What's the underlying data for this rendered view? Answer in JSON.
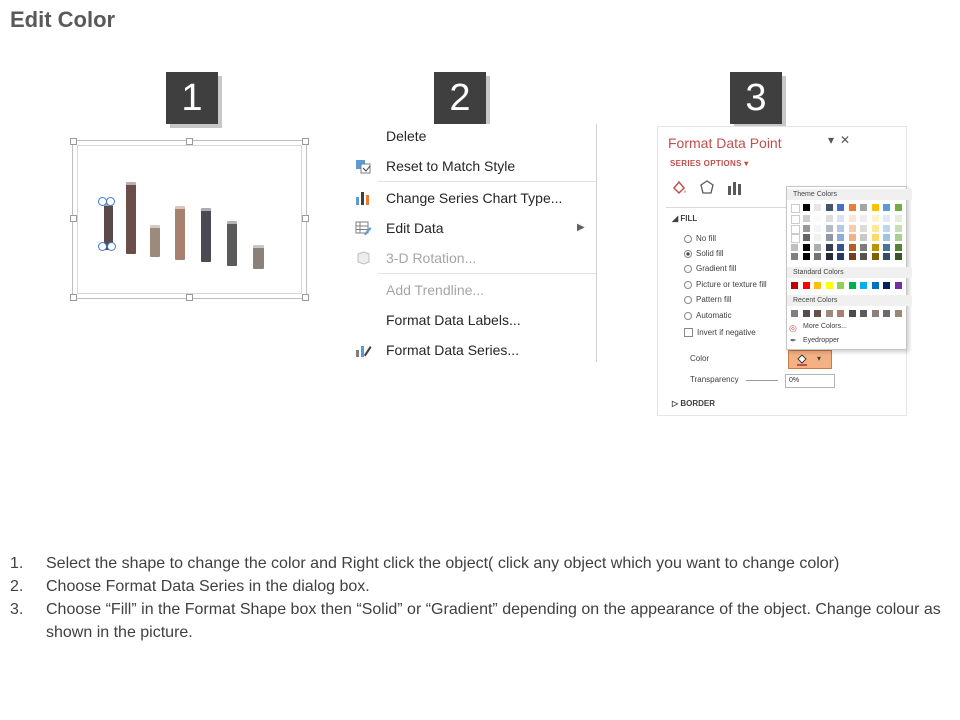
{
  "title": "Edit Color",
  "steps": [
    "1",
    "2",
    "3"
  ],
  "chart_bar_colors": [
    "#5a4a4e",
    "#6a4e4a",
    "#9c8a7a",
    "#a88070",
    "#4a4a52",
    "#5a5a5a",
    "#8a8278"
  ],
  "menu": {
    "items": [
      {
        "label": "Delete",
        "icon": "none",
        "disabled": false
      },
      {
        "label": "Reset to Match Style",
        "icon": "reset-style-icon",
        "disabled": false
      },
      {
        "label": "Change Series Chart Type...",
        "icon": "bar-chart-icon",
        "disabled": false
      },
      {
        "label": "Edit Data",
        "icon": "edit-data-icon",
        "disabled": false
      },
      {
        "label": "3-D Rotation...",
        "icon": "cube-icon",
        "disabled": true
      },
      {
        "label": "Add Trendline...",
        "icon": "none",
        "disabled": true
      },
      {
        "label": "Format Data Labels...",
        "icon": "none",
        "disabled": false
      },
      {
        "label": "Format Data Series...",
        "icon": "format-series-icon",
        "disabled": false
      }
    ]
  },
  "pane": {
    "title": "Format Data Point",
    "series_options": "SERIES OPTIONS",
    "fill_header": "FILL",
    "fill_options": [
      "No fill",
      "Solid fill",
      "Gradient fill",
      "Picture or texture fill",
      "Pattern fill",
      "Automatic"
    ],
    "selected_fill": "Solid fill",
    "invert_label": "Invert if negative",
    "color_label": "Color",
    "transparency_label": "Transparency",
    "transparency_value": "0%",
    "border_header": "BORDER",
    "accent_color": "#c0504d"
  },
  "picker": {
    "theme_colors_label": "Theme Colors",
    "standard_colors_label": "Standard Colors",
    "recent_colors_label": "Recent Colors",
    "more_colors_label": "More Colors...",
    "eyedropper_label": "Eyedropper",
    "theme_top": [
      "#ffffff",
      "#000000",
      "#e7e6e6",
      "#44546a",
      "#4472c4",
      "#ed7d31",
      "#a5a5a5",
      "#ffc000",
      "#5b9bd5",
      "#70ad47"
    ],
    "standard": [
      "#c00000",
      "#ff0000",
      "#ffc000",
      "#ffff00",
      "#92d050",
      "#00b050",
      "#00b0f0",
      "#0070c0",
      "#002060",
      "#7030a0"
    ],
    "recent": [
      "#7f7f7f",
      "#5a4a4e",
      "#6a4e4a",
      "#9c8a7a",
      "#a88070",
      "#4a4a52",
      "#5a5a5a",
      "#8a8278",
      "#6b6b6b",
      "#998877"
    ]
  },
  "instructions": [
    {
      "num": "1.",
      "text": "Select the shape to change the color and Right click the object( click any object which you want to change color)"
    },
    {
      "num": "2.",
      "text": "Choose Format Data Series in the dialog box."
    },
    {
      "num": "3.",
      "text": "Choose “Fill” in the Format Shape box then “Solid” or “Gradient” depending on the appearance of the object. Change colour as shown in the picture."
    }
  ]
}
